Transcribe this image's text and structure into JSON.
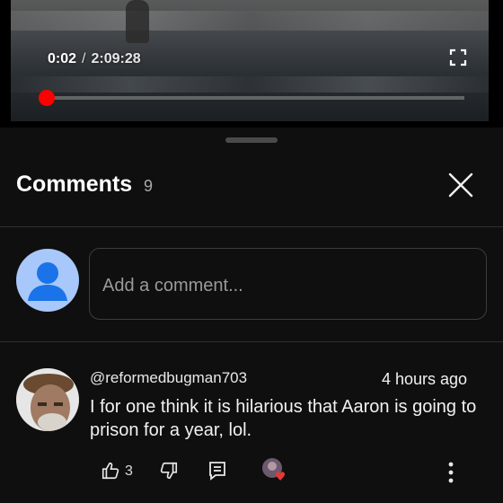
{
  "player": {
    "current_time": "0:02",
    "separator": "/",
    "duration": "2:09:28",
    "progress_fraction": 0.003
  },
  "comments_panel": {
    "title": "Comments",
    "count": "9",
    "add_comment_placeholder": "Add a comment..."
  },
  "comment": {
    "author": "@reformedbugman703",
    "time_ago": "4 hours ago",
    "text": "I for one think it is hilarious that Aaron is going to prison for a year, lol.",
    "like_count": "3"
  },
  "colors": {
    "accent_red": "#ff0000",
    "background": "#0f0f0f",
    "avatar_blue": "#a8c7fa",
    "heart_red": "#e53935"
  }
}
